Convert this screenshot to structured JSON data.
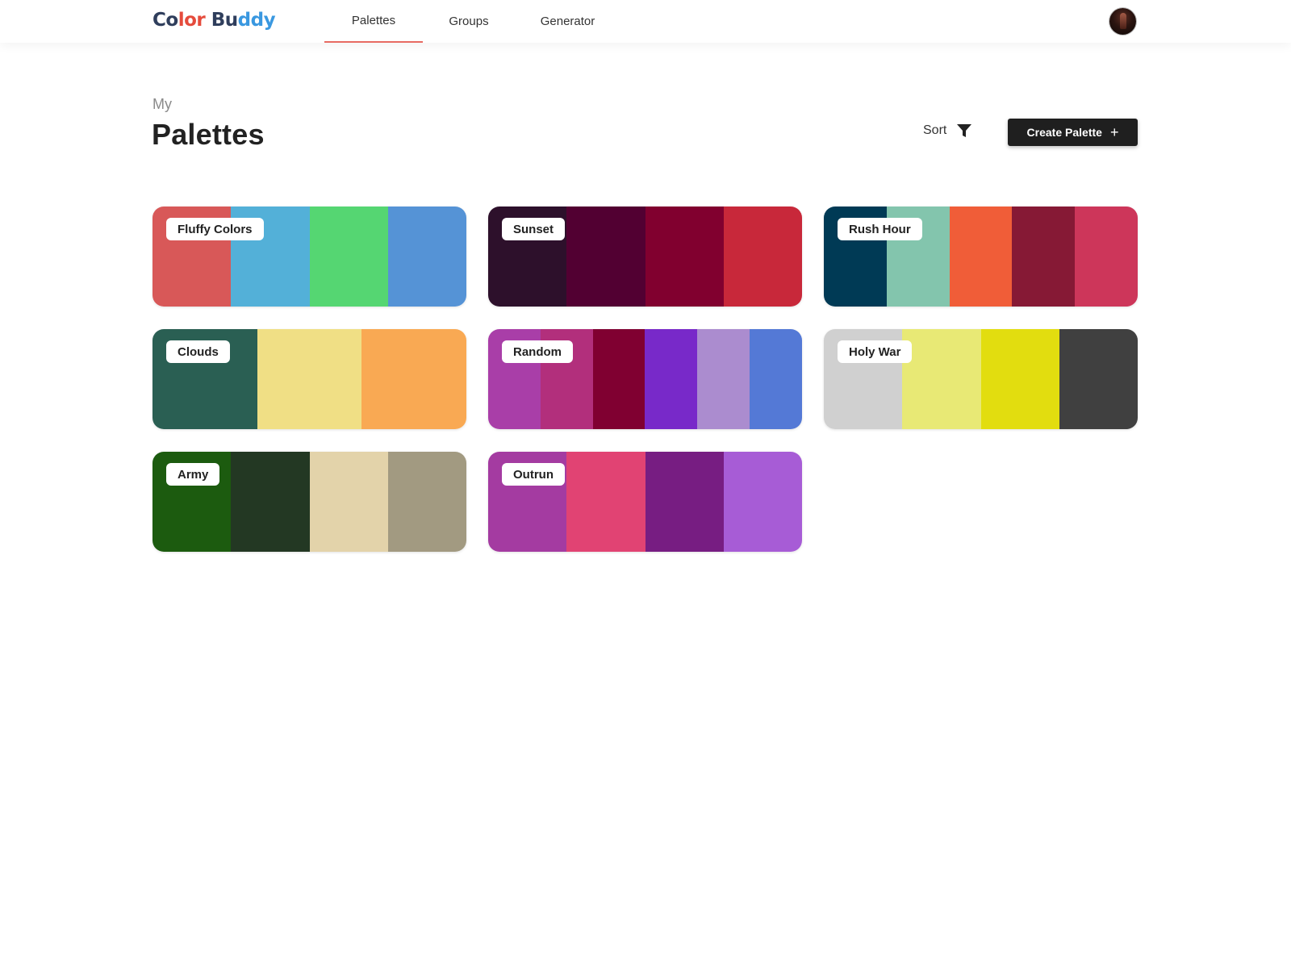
{
  "app": {
    "brand": {
      "part1": "Co",
      "part2": "lor",
      "part3": " Bu",
      "part4": "ddy"
    },
    "colors": {
      "brand_dark": "#2f3e5c",
      "brand_red": "#e54b3c",
      "brand_blue": "#3a98e0",
      "accent_underline": "#e86b63",
      "button_bg": "#1f1f1f"
    }
  },
  "nav": {
    "tabs": [
      {
        "label": "Palettes",
        "active": true
      },
      {
        "label": "Groups",
        "active": false
      },
      {
        "label": "Generator",
        "active": false
      }
    ]
  },
  "header": {
    "avatar_icon": "user-avatar"
  },
  "page": {
    "subtitle": "My",
    "title": "Palettes",
    "sort_label": "Sort",
    "sort_icon": "filter-icon",
    "create_label": "Create Palette",
    "create_icon": "plus-icon"
  },
  "palettes": [
    {
      "name": "Fluffy Colors",
      "colors": [
        "#d85858",
        "#53b0d8",
        "#55d672",
        "#5593d6"
      ]
    },
    {
      "name": "Sunset",
      "colors": [
        "#2d102b",
        "#520032",
        "#81002f",
        "#c8283a"
      ]
    },
    {
      "name": "Rush Hour",
      "colors": [
        "#003a55",
        "#83c5ad",
        "#f05d38",
        "#861935",
        "#cd365a"
      ]
    },
    {
      "name": "Clouds",
      "colors": [
        "#2a5f53",
        "#f0df85",
        "#f9a953"
      ]
    },
    {
      "name": "Random",
      "colors": [
        "#a93ea8",
        "#b22f7c",
        "#800031",
        "#7829c9",
        "#ab8ccf",
        "#5479d6"
      ]
    },
    {
      "name": "Holy War",
      "colors": [
        "#d0d0d0",
        "#e8e975",
        "#e2dd0f",
        "#404040"
      ]
    },
    {
      "name": "Army",
      "colors": [
        "#1c5b0f",
        "#233823",
        "#e3d3aa",
        "#a29a81"
      ]
    },
    {
      "name": "Outrun",
      "colors": [
        "#a43ba1",
        "#e14373",
        "#771d82",
        "#a75cd6"
      ]
    }
  ]
}
